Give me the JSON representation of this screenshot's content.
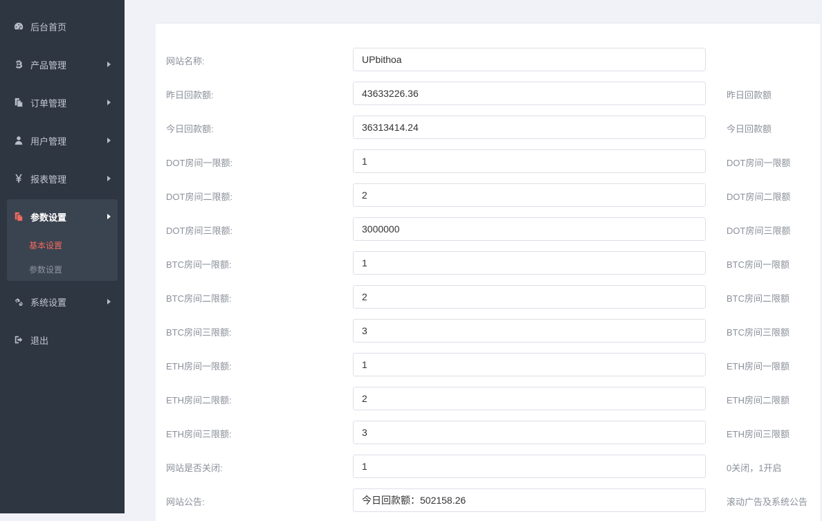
{
  "sidebar": {
    "items": [
      {
        "label": "后台首页",
        "icon": "dashboard-icon"
      },
      {
        "label": "产品管理",
        "icon": "bitcoin-icon"
      },
      {
        "label": "订单管理",
        "icon": "copy-icon"
      },
      {
        "label": "用户管理",
        "icon": "user-icon"
      },
      {
        "label": "报表管理",
        "icon": "yen-icon"
      },
      {
        "label": "参数设置",
        "icon": "files-icon"
      },
      {
        "label": "系统设置",
        "icon": "gears-icon"
      },
      {
        "label": "退出",
        "icon": "sign-out-icon"
      }
    ],
    "sub_items": [
      {
        "label": "基本设置",
        "active": true
      },
      {
        "label": "参数设置",
        "active": false
      }
    ],
    "accent_color": "#f06a5e"
  },
  "form": {
    "rows": [
      {
        "label": "网站名称:",
        "value": "UPbithoa",
        "hint": ""
      },
      {
        "label": "昨日回款额:",
        "value": "43633226.36",
        "hint": "昨日回款额"
      },
      {
        "label": "今日回款额:",
        "value": "36313414.24",
        "hint": "今日回款额"
      },
      {
        "label": "DOT房间一限额:",
        "value": "1",
        "hint": "DOT房间一限额"
      },
      {
        "label": "DOT房间二限额:",
        "value": "2",
        "hint": "DOT房间二限额"
      },
      {
        "label": "DOT房间三限额:",
        "value": "3000000",
        "hint": "DOT房间三限额"
      },
      {
        "label": "BTC房间一限额:",
        "value": "1",
        "hint": "BTC房间一限额"
      },
      {
        "label": "BTC房间二限额:",
        "value": "2",
        "hint": "BTC房间二限额"
      },
      {
        "label": "BTC房间三限额:",
        "value": "3",
        "hint": "BTC房间三限额"
      },
      {
        "label": "ETH房间一限额:",
        "value": "1",
        "hint": "ETH房间一限额"
      },
      {
        "label": "ETH房间二限额:",
        "value": "2",
        "hint": "ETH房间二限额"
      },
      {
        "label": "ETH房间三限额:",
        "value": "3",
        "hint": "ETH房间三限额"
      },
      {
        "label": "网站是否关闭:",
        "value": "1",
        "hint": "0关闭，1开启"
      },
      {
        "label": "网站公告:",
        "value": "今日回款额：502158.26",
        "hint": "滚动广告及系统公告"
      }
    ]
  }
}
